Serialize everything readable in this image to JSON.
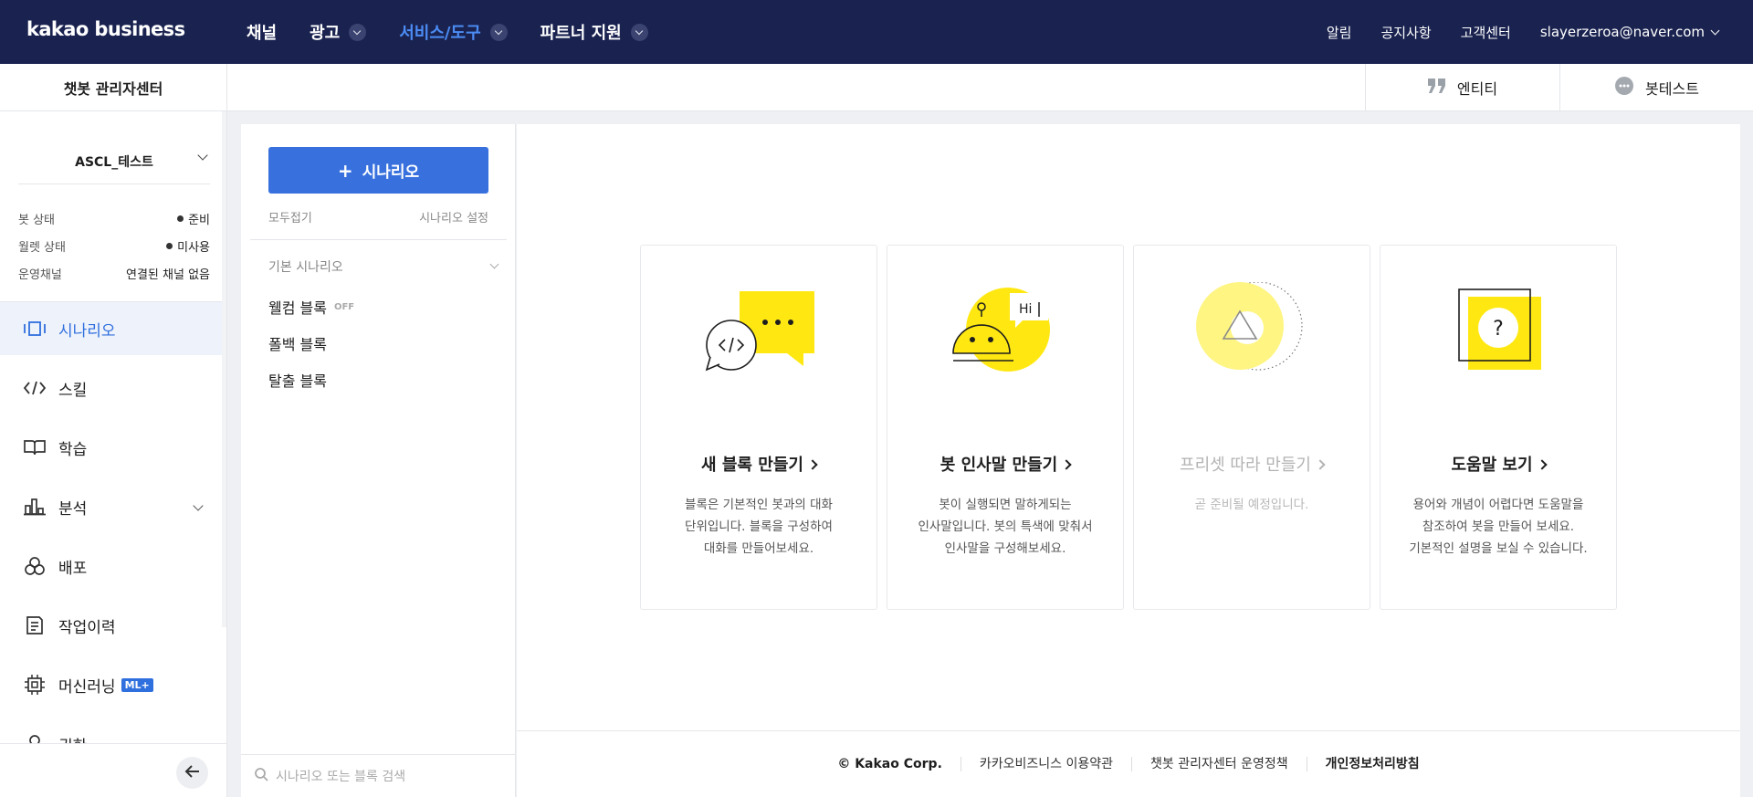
{
  "topnav": {
    "logo": "kakao business",
    "menu": [
      {
        "label": "채널",
        "has_dropdown": false,
        "active": false
      },
      {
        "label": "광고",
        "has_dropdown": true,
        "active": false
      },
      {
        "label": "서비스/도구",
        "has_dropdown": true,
        "active": true
      },
      {
        "label": "파트너 지원",
        "has_dropdown": true,
        "active": false
      }
    ],
    "right": {
      "alarm": "알림",
      "notice": "공지사항",
      "support": "고객센터",
      "user": "slayerzeroa@naver.com"
    }
  },
  "subbar": {
    "title": "챗봇 관리자센터",
    "entity": "엔티티",
    "bot_test": "봇테스트"
  },
  "sidebar": {
    "bot_name": "ASCL_테스트",
    "status": [
      {
        "key": "봇 상태",
        "value": "준비"
      },
      {
        "key": "월렛 상태",
        "value": "미사용"
      },
      {
        "key": "운영채널",
        "value": "연결된 채널 없음"
      }
    ],
    "items": [
      {
        "label": "시나리오",
        "icon": "scenario-icon",
        "active": true
      },
      {
        "label": "스킬",
        "icon": "code-icon"
      },
      {
        "label": "학습",
        "icon": "book-icon"
      },
      {
        "label": "분석",
        "icon": "chart-icon"
      },
      {
        "label": "배포",
        "icon": "deploy-icon"
      },
      {
        "label": "작업이력",
        "icon": "history-icon"
      },
      {
        "label": "머신러닝",
        "icon": "chip-icon",
        "badge": "ML+"
      },
      {
        "label": "권한",
        "icon": "user-icon"
      }
    ]
  },
  "scenario": {
    "add_button": "시나리오",
    "collapse_all": "모두접기",
    "settings": "시나리오 설정",
    "group": "기본 시나리오",
    "blocks": [
      {
        "label": "웰컴 블록",
        "tag": "OFF"
      },
      {
        "label": "폴백 블록"
      },
      {
        "label": "탈출 블록"
      }
    ],
    "search_placeholder": "시나리오 또는 블록 검색"
  },
  "cards": [
    {
      "title": "새 블록 만들기",
      "desc": "블록은 기본적인 봇과의 대화\n단위입니다. 블록을 구성하여\n대화를 만들어보세요.",
      "disabled": false
    },
    {
      "title": "봇 인사말 만들기",
      "desc": "봇이 실행되면 말하게되는\n인사말입니다. 봇의 특색에 맞춰서\n인사말을 구성해보세요.",
      "disabled": false,
      "hi": "Hi"
    },
    {
      "title": "프리셋 따라 만들기",
      "desc": "곧 준비될 예정입니다.",
      "disabled": true
    },
    {
      "title": "도움말 보기",
      "desc": "용어와 개념이 어렵다면 도움말을\n참조하여 봇을 만들어 보세요.\n기본적인 설명을 보실 수 있습니다.",
      "disabled": false
    }
  ],
  "footer": {
    "copyright": "© Kakao Corp.",
    "terms": "카카오비즈니스 이용약관",
    "policy": "챗봇 관리자센터 운영정책",
    "privacy": "개인정보처리방침"
  },
  "colors": {
    "nav_bg": "#1a2350",
    "accent": "#3871de",
    "yellow": "#ffe812"
  }
}
